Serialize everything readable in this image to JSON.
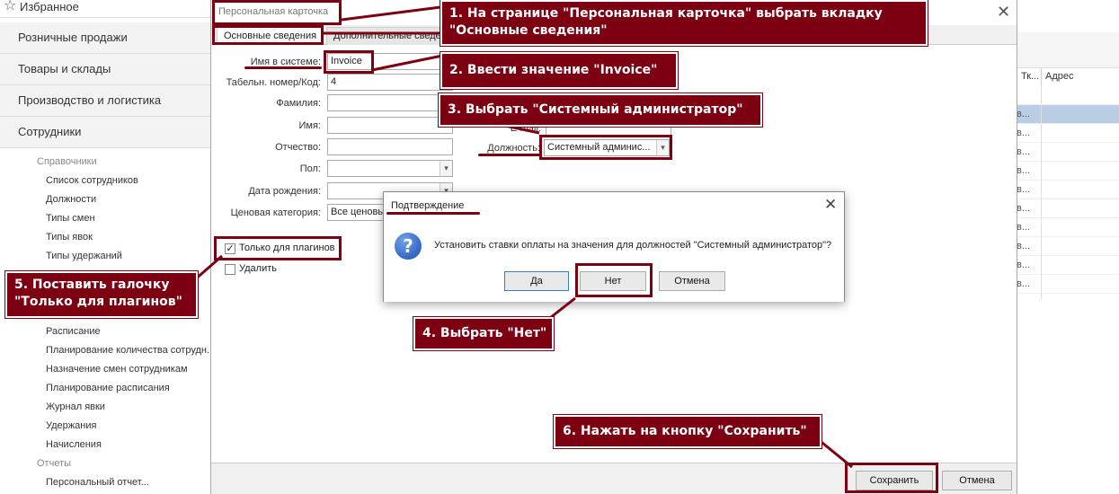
{
  "sidebar": {
    "favorites": "Избранное",
    "sections": [
      "Розничные продажи",
      "Товары и склады",
      "Производство и логистика",
      "Сотрудники"
    ],
    "groups": [
      {
        "head": "Справочники",
        "items": [
          "Список сотрудников",
          "Должности",
          "Типы смен",
          "Типы явок",
          "Типы удержаний"
        ]
      },
      {
        "items": [
          "Расписание",
          "Планирование количества сотрудн...",
          "Назначение смен сотрудникам",
          "Планирование расписания",
          "Журнал явки",
          "Удержания",
          "Начисления"
        ]
      },
      {
        "head": "Отчеты",
        "items": [
          "Персональный отчет..."
        ]
      }
    ]
  },
  "grid": {
    "col1": "Тк...",
    "col2": "Адрес",
    "cells": [
      "в...",
      "в...",
      "в...",
      "в...",
      "в...",
      "в...",
      "в...",
      "в...",
      "в...",
      "в..."
    ]
  },
  "card": {
    "title": "Персональная карточка",
    "tabs": [
      "Основные сведения",
      "Дополнительные сведения"
    ],
    "fields": {
      "login_label": "Имя в системе:",
      "login_value": "Invoice",
      "code_label": "Табельн. номер/Код:",
      "code_value": "4",
      "lastname_label": "Фамилия:",
      "firstname_label": "Имя:",
      "middlename_label": "Отчество:",
      "gender_label": "Пол:",
      "birth_label": "Дата рождения:",
      "price_label": "Ценовая категория:",
      "price_value": "Все ценовые...",
      "email_label": "E-mail:",
      "position_label": "Должность:",
      "position_value": "Системный админис..."
    },
    "plugins_only": "Только для плагинов",
    "delete": "Удалить",
    "save": "Сохранить",
    "cancel": "Отмена"
  },
  "dialog": {
    "title": "Подтверждение",
    "message": "Установить ставки оплаты на значения для должностей \"Системный администратор\"?",
    "yes": "Да",
    "no": "Нет",
    "cancel": "Отмена"
  },
  "annotations": {
    "step1": [
      "1. На странице \"Персональная карточка\" выбрать вкладку",
      "\"Основные сведения\""
    ],
    "step2": "2. Ввести значение \"Invoice\"",
    "step3": "3. Выбрать \"Системный администратор\"",
    "step4": "4. Выбрать \"Нет\"",
    "step5": [
      "5. Поставить галочку",
      "\"Только для плагинов\""
    ],
    "step6": "6. Нажать на кнопку \"Сохранить\""
  },
  "colors": {
    "annotation": "#7d0012",
    "selected_row": "#b9cde5"
  }
}
